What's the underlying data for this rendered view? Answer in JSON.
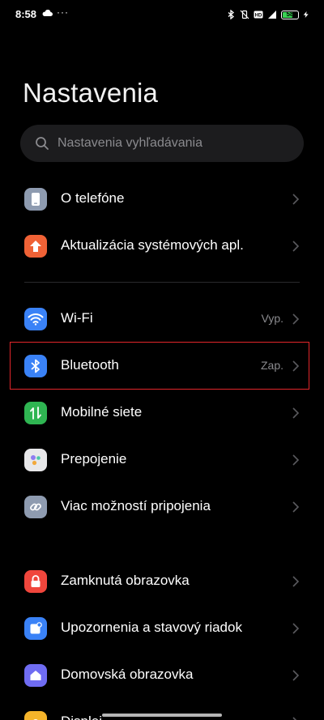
{
  "status_bar": {
    "time": "8:58",
    "dots": "···",
    "battery": "58",
    "battery_level": 0.58
  },
  "title": "Nastavenia",
  "search": {
    "placeholder": "Nastavenia vyhľadávania"
  },
  "items": [
    {
      "label": "O telefóne",
      "icon": "phone-icon",
      "color": "#8e9bb0"
    },
    {
      "label": "Aktualizácia systémových apl.",
      "icon": "arrow-up-icon",
      "color": "#f06236"
    },
    {
      "label": "Wi-Fi",
      "value": "Vyp.",
      "icon": "wifi-icon",
      "color": "#3a82f7"
    },
    {
      "label": "Bluetooth",
      "value": "Zap.",
      "icon": "bluetooth-icon",
      "color": "#3a82f7"
    },
    {
      "label": "Mobilné siete",
      "icon": "mobile-data-icon",
      "color": "#2fb552"
    },
    {
      "label": "Prepojenie",
      "icon": "interconnect-icon",
      "color": "#e8e8ea"
    },
    {
      "label": "Viac možností pripojenia",
      "icon": "link-icon",
      "color": "#8e9bb0"
    },
    {
      "label": "Zamknutá obrazovka",
      "icon": "lock-icon",
      "color": "#f0463c"
    },
    {
      "label": "Upozornenia a stavový riadok",
      "icon": "notification-icon",
      "color": "#3a82f7"
    },
    {
      "label": "Domovská obrazovka",
      "icon": "home-icon",
      "color": "#6f6cf2"
    },
    {
      "label": "Displej",
      "icon": "sun-icon",
      "color": "#f5b42a"
    }
  ],
  "colors": {
    "background": "#000000",
    "highlight": "#e3262b",
    "secondary_text": "#8a8a8e"
  }
}
